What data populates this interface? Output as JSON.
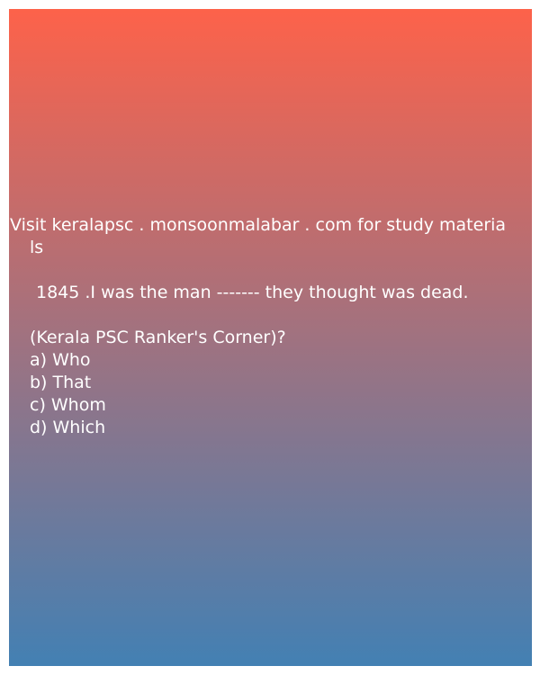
{
  "source": {
    "line1": "Visit keralapsc . monsoonmalabar . com for study materia",
    "line2": "ls"
  },
  "question": {
    "text": "1845 .I was the man ------- they thought was dead.",
    "attribution": "(Kerala PSC Ranker's Corner)?"
  },
  "options": [
    {
      "label": "a) Who"
    },
    {
      "label": "b) That"
    },
    {
      "label": "c) Whom"
    },
    {
      "label": "d) Which"
    }
  ],
  "colors": {
    "gradient_top": "#fd624a",
    "gradient_mid": "#a07280",
    "gradient_bottom": "#4380b3",
    "text": "#ffffff"
  }
}
